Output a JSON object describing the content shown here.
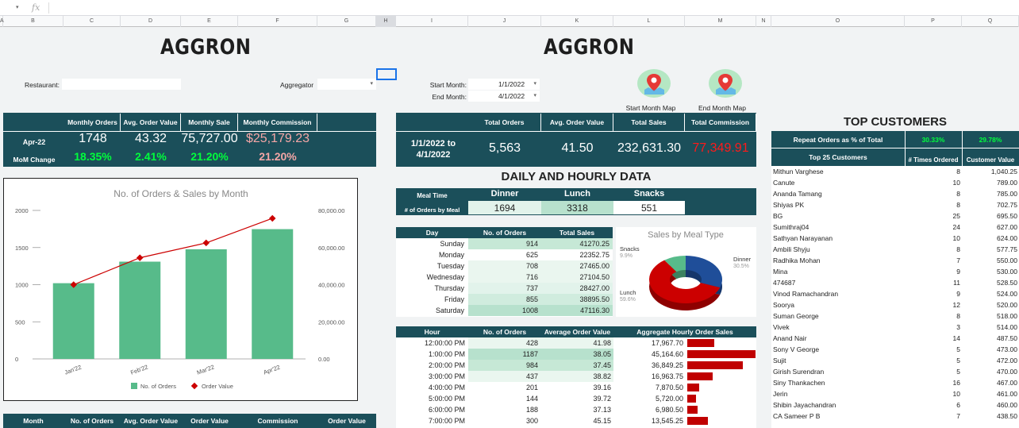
{
  "sheet": {
    "fx_label": "fx",
    "columns": [
      "A",
      "B",
      "C",
      "D",
      "E",
      "F",
      "G",
      "H",
      "I",
      "J",
      "K",
      "L",
      "M",
      "N",
      "O",
      "P",
      "Q"
    ]
  },
  "left": {
    "title": "AGGRON",
    "restaurant_label": "Restaurant:",
    "aggregator_label": "Aggregator",
    "headers": [
      "Monthly Orders",
      "Avg. Order Value",
      "Monthly Sale",
      "Monthly Commission"
    ],
    "month": "Apr-22",
    "mom_label": "MoM Change",
    "values": [
      "1748",
      "43.32",
      "75,727.00",
      "$25,179.23"
    ],
    "mom": [
      "18.35%",
      "2.41%",
      "21.20%",
      "21.20%"
    ],
    "bottom_headers": [
      "Month",
      "No. of Orders",
      "Avg. Order Value",
      "Order Value",
      "Commission",
      "Order Value"
    ]
  },
  "chart_data": {
    "type": "bar",
    "title": "No. of Orders & Sales by Month",
    "categories": [
      "Jan'22",
      "Feb'22",
      "Mar'22",
      "Apr'22"
    ],
    "series": [
      {
        "name": "No. of Orders",
        "type": "bar",
        "values": [
          1020,
          1310,
          1477,
          1748
        ],
        "color": "#57bb8a"
      },
      {
        "name": "Order Value",
        "type": "line",
        "values": [
          40000,
          54500,
          62500,
          75727
        ],
        "color": "#cc0000"
      }
    ],
    "y_left_ticks": [
      "0",
      "500",
      "1000",
      "1500",
      "2000"
    ],
    "y_right_ticks": [
      "0.00",
      "20,000.00",
      "40,000.00",
      "60,000.00",
      "80,000.00"
    ],
    "ylim_left": [
      0,
      2000
    ],
    "ylim_right": [
      0,
      80000
    ],
    "legend_position": "bottom"
  },
  "right": {
    "title": "AGGRON",
    "start_month_label": "Start Month:",
    "end_month_label": "End Month:",
    "start_month": "1/1/2022",
    "end_month": "4/1/2022",
    "start_map_label": "Start Month Map",
    "end_map_label": "End Month Map",
    "headers": [
      "Total Orders",
      "Avg. Order Value",
      "Total Sales",
      "Total Commission"
    ],
    "period": "1/1/2022 to 4/1/2022",
    "values": [
      "5,563",
      "41.50",
      "232,631.30",
      "77,349.91"
    ],
    "daily_title": "DAILY AND HOURLY DATA",
    "meal_time_label": "Meal Time",
    "orders_by_meal_label": "# of Orders by Meal",
    "meals": [
      "Dinner",
      "Lunch",
      "Snacks"
    ],
    "meal_orders": [
      "1694",
      "3318",
      "551"
    ],
    "day_headers": [
      "Day",
      "No. of Orders",
      "Total Sales"
    ],
    "days": [
      {
        "day": "Sunday",
        "orders": "914",
        "sales": "41270.25"
      },
      {
        "day": "Monday",
        "orders": "625",
        "sales": "22352.75"
      },
      {
        "day": "Tuesday",
        "orders": "708",
        "sales": "27465.00"
      },
      {
        "day": "Wednesday",
        "orders": "716",
        "sales": "27104.50"
      },
      {
        "day": "Thursday",
        "orders": "737",
        "sales": "28427.00"
      },
      {
        "day": "Friday",
        "orders": "855",
        "sales": "38895.50"
      },
      {
        "day": "Saturday",
        "orders": "1008",
        "sales": "47116.30"
      }
    ],
    "pie": {
      "title": "Sales by Meal Type",
      "slices": [
        {
          "label": "Dinner",
          "pct": "30.5%",
          "value": 30.5,
          "color": "#1f4e99"
        },
        {
          "label": "Lunch",
          "pct": "59.6%",
          "value": 59.6,
          "color": "#cc0000"
        },
        {
          "label": "Snacks",
          "pct": "9.9%",
          "value": 9.9,
          "color": "#57bb8a"
        }
      ]
    },
    "hour_headers": [
      "Hour",
      "No. of Orders",
      "Average Order Value",
      "Aggregate Hourly Order Sales"
    ],
    "hours": [
      {
        "hour": "12:00:00 PM",
        "orders": "428",
        "avg": "41.98",
        "sales": "17,967.70",
        "v": 17967.7
      },
      {
        "hour": "1:00:00 PM",
        "orders": "1187",
        "avg": "38.05",
        "sales": "45,164.60",
        "v": 45164.6
      },
      {
        "hour": "2:00:00 PM",
        "orders": "984",
        "avg": "37.45",
        "sales": "36,849.25",
        "v": 36849.25
      },
      {
        "hour": "3:00:00 PM",
        "orders": "437",
        "avg": "38.82",
        "sales": "16,963.75",
        "v": 16963.75
      },
      {
        "hour": "4:00:00 PM",
        "orders": "201",
        "avg": "39.16",
        "sales": "7,870.50",
        "v": 7870.5
      },
      {
        "hour": "5:00:00 PM",
        "orders": "144",
        "avg": "39.72",
        "sales": "5,720.00",
        "v": 5720.0
      },
      {
        "hour": "6:00:00 PM",
        "orders": "188",
        "avg": "37.13",
        "sales": "6,980.50",
        "v": 6980.5
      },
      {
        "hour": "7:00:00 PM",
        "orders": "300",
        "avg": "45.15",
        "sales": "13,545.25",
        "v": 13545.25
      }
    ]
  },
  "customers": {
    "title": "TOP CUSTOMERS",
    "repeat_label": "Repeat Orders as % of Total",
    "repeat_values": [
      "30.33%",
      "29.78%"
    ],
    "headers": [
      "Top 25 Customers",
      "# Times Ordered",
      "Customer Value"
    ],
    "rows": [
      {
        "name": "Mithun Varghese",
        "times": "8",
        "value": "1,040.25"
      },
      {
        "name": "Canute",
        "times": "10",
        "value": "789.00"
      },
      {
        "name": "Ananda Tamang",
        "times": "8",
        "value": "785.00"
      },
      {
        "name": "Shiyas PK",
        "times": "8",
        "value": "702.75"
      },
      {
        "name": "BG",
        "times": "25",
        "value": "695.50"
      },
      {
        "name": "Sumithraj04",
        "times": "24",
        "value": "627.00"
      },
      {
        "name": "Sathyan Narayanan",
        "times": "10",
        "value": "624.00"
      },
      {
        "name": "Ambili Shyju",
        "times": "8",
        "value": "577.75"
      },
      {
        "name": "Radhika Mohan",
        "times": "7",
        "value": "550.00"
      },
      {
        "name": "Mina",
        "times": "9",
        "value": "530.00"
      },
      {
        "name": "474687",
        "times": "11",
        "value": "528.50"
      },
      {
        "name": "Vinod Ramachandran",
        "times": "9",
        "value": "524.00"
      },
      {
        "name": "Soorya",
        "times": "12",
        "value": "520.00"
      },
      {
        "name": "Suman George",
        "times": "8",
        "value": "518.00"
      },
      {
        "name": "Vivek",
        "times": "3",
        "value": "514.00"
      },
      {
        "name": "Anand Nair",
        "times": "14",
        "value": "487.50"
      },
      {
        "name": "Sony V George",
        "times": "5",
        "value": "473.00"
      },
      {
        "name": "Sujit",
        "times": "5",
        "value": "472.00"
      },
      {
        "name": "Girish Surendran",
        "times": "5",
        "value": "470.00"
      },
      {
        "name": "Siny Thankachen",
        "times": "16",
        "value": "467.00"
      },
      {
        "name": "Jerin",
        "times": "10",
        "value": "461.00"
      },
      {
        "name": "Shibin Jayachandran",
        "times": "6",
        "value": "460.00"
      },
      {
        "name": "CA Sameer P B",
        "times": "7",
        "value": "438.50"
      }
    ]
  }
}
